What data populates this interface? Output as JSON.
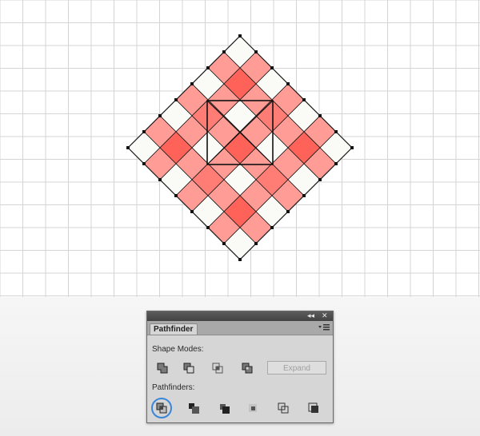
{
  "panel": {
    "collapse_glyph": "◂◂",
    "close_glyph": "✕",
    "tab_label": "Pathfinder",
    "menu_icon": "panel-menu-icon"
  },
  "shape_modes": {
    "label": "Shape Modes:",
    "buttons": [
      "unite-icon",
      "minus-front-icon",
      "intersect-icon",
      "exclude-icon"
    ],
    "expand_label": "Expand"
  },
  "pathfinders": {
    "label": "Pathfinders:",
    "buttons": [
      "divide-icon",
      "trim-icon",
      "merge-icon",
      "crop-icon",
      "outline-icon",
      "minus-back-icon"
    ],
    "selected": "divide-icon"
  },
  "colors": {
    "light_red": "#ff9c95",
    "mid_red": "#ff7d75",
    "dark_red": "#ff6259",
    "off_white": "#fafaf7",
    "accent_ring": "#3a86d8"
  }
}
